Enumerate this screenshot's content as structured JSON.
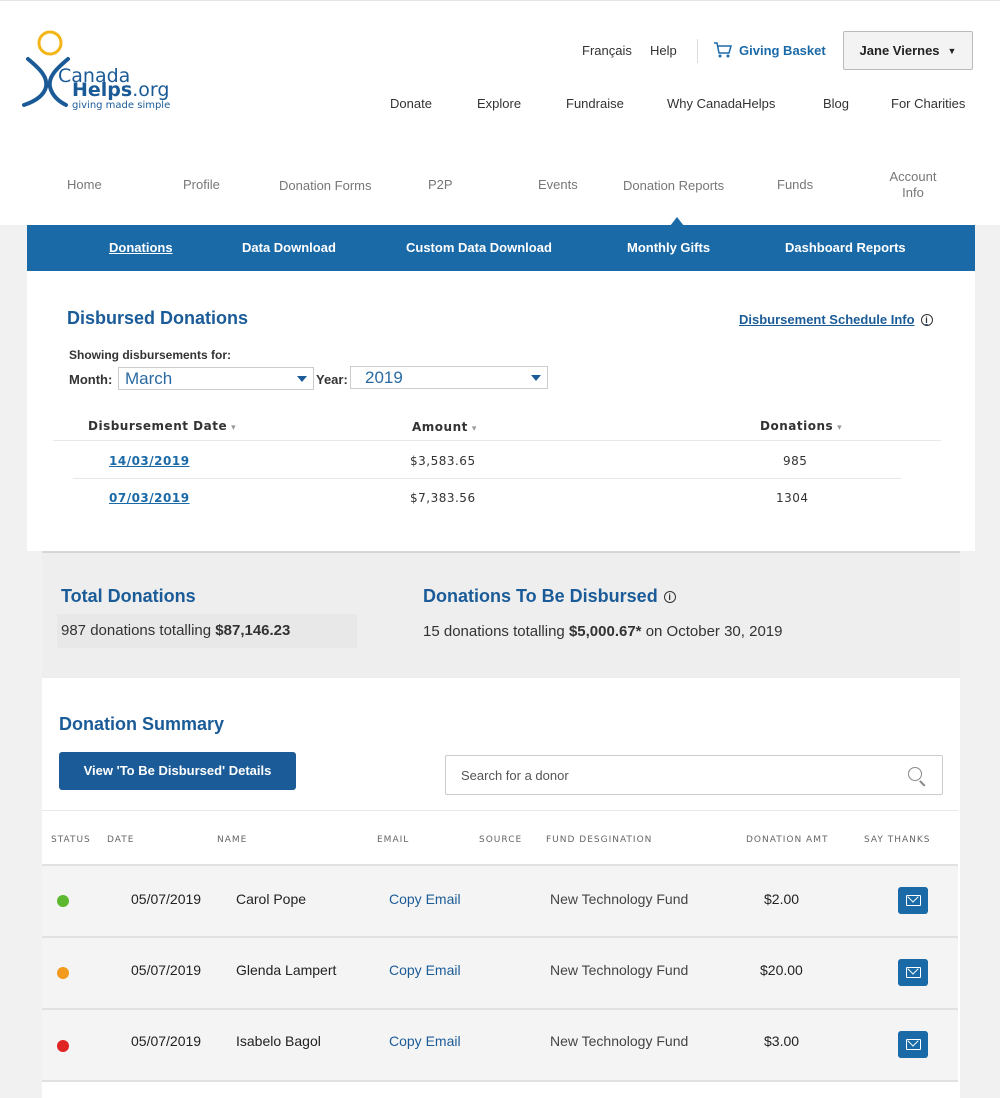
{
  "logo": {
    "line1": "Canada",
    "line2_a": "Helps",
    "line2_b": ".org",
    "tagline": "giving made simple"
  },
  "utility": {
    "lang": "Français",
    "help": "Help",
    "basket": "Giving Basket",
    "user": "Jane Viernes"
  },
  "main_nav": [
    "Donate",
    "Explore",
    "Fundraise",
    "Why CanadaHelps",
    "Blog",
    "For Charities"
  ],
  "sub_nav": [
    "Home",
    "Profile",
    "Donation Forms",
    "P2P",
    "Events",
    "Donation Reports",
    "Funds",
    "Account",
    "Info"
  ],
  "blue_nav": [
    "Donations",
    "Data Download",
    "Custom Data Download",
    "Monthly Gifts",
    "Dashboard Reports"
  ],
  "disbursed": {
    "title": "Disbursed Donations",
    "schedule_link": "Disbursement Schedule Info",
    "showing": "Showing disbursements for:",
    "month_label": "Month:",
    "month": "March",
    "year_label": "Year:",
    "year": "2019",
    "headers": [
      "Disbursement Date",
      "Amount",
      "Donations"
    ],
    "rows": [
      {
        "date": "14/03/2019",
        "amount": "$3,583.65",
        "donations": "985"
      },
      {
        "date": "07/03/2019",
        "amount": "$7,383.56",
        "donations": "1304"
      }
    ]
  },
  "totals": {
    "total_title": "Total Donations",
    "total_text": "987 donations totalling",
    "total_amount": "$87,146.23",
    "pending_title": "Donations To Be Disbursed",
    "pending_text": "15 donations totalling",
    "pending_amount": "$5,000.67*",
    "pending_date": "on October 30, 2019"
  },
  "summary": {
    "title": "Donation Summary",
    "view_button": "View 'To Be Disbursed' Details",
    "search_placeholder": "Search for a donor",
    "headers": [
      "STATUS",
      "DATE",
      "NAME",
      "EMAIL",
      "SOURCE",
      "FUND DESGINATION",
      "DONATION AMT",
      "SAY THANKS"
    ],
    "rows": [
      {
        "status_color": "#5cb82f",
        "date": "05/07/2019",
        "name": "Carol Pope",
        "email": "Copy Email",
        "fund": "New Technology Fund",
        "amount": "$2.00"
      },
      {
        "status_color": "#f39a1c",
        "date": "05/07/2019",
        "name": "Glenda Lampert",
        "email": "Copy Email",
        "fund": "New Technology Fund",
        "amount": "$20.00"
      },
      {
        "status_color": "#e02424",
        "date": "05/07/2019",
        "name": "Isabelo Bagol",
        "email": "Copy Email",
        "fund": "New Technology Fund",
        "amount": "$3.00"
      }
    ]
  },
  "colors": {
    "brand_blue": "#1b6aa8",
    "heading_blue": "#1b5c98"
  }
}
